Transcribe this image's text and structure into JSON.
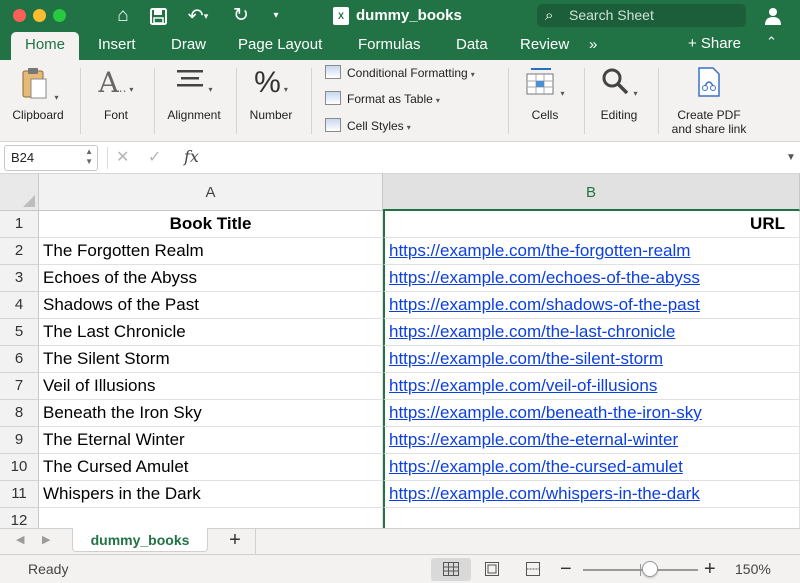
{
  "window": {
    "title": "dummy_books",
    "file_badge": "X",
    "search_placeholder": "Search Sheet",
    "accent_color": "#217346"
  },
  "quick_access": {
    "icons": [
      "home-icon",
      "save-icon",
      "undo-icon",
      "redo-icon"
    ]
  },
  "tabs": [
    {
      "label": "Home",
      "active": true
    },
    {
      "label": "Insert"
    },
    {
      "label": "Draw"
    },
    {
      "label": "Page Layout"
    },
    {
      "label": "Formulas"
    },
    {
      "label": "Data"
    },
    {
      "label": "Review"
    },
    {
      "label": "»"
    }
  ],
  "share": {
    "label": "+ Share",
    "collapse": "⌃"
  },
  "ribbon": {
    "clipboard": "Clipboard",
    "font": "Font",
    "alignment": "Alignment",
    "number": "Number",
    "conditional_formatting": "Conditional Formatting",
    "format_as_table": "Format as Table",
    "cell_styles": "Cell Styles",
    "cells": "Cells",
    "editing": "Editing",
    "create_pdf_line1": "Create PDF",
    "create_pdf_line2": "and share link"
  },
  "formula_bar": {
    "name_box": "B24",
    "cancel": "✕",
    "enter": "✓",
    "fx": "fx",
    "content": ""
  },
  "columns": [
    {
      "label": "A",
      "selected": false
    },
    {
      "label": "B",
      "selected": true
    }
  ],
  "rows": [
    {
      "num": "1",
      "a": "Book Title",
      "b": "URL"
    },
    {
      "num": "2",
      "a": "The Forgotten Realm",
      "b": "https://example.com/the-forgotten-realm"
    },
    {
      "num": "3",
      "a": "Echoes of the Abyss",
      "b": "https://example.com/echoes-of-the-abyss"
    },
    {
      "num": "4",
      "a": "Shadows of the Past",
      "b": "https://example.com/shadows-of-the-past"
    },
    {
      "num": "5",
      "a": "The Last Chronicle",
      "b": "https://example.com/the-last-chronicle"
    },
    {
      "num": "6",
      "a": "The Silent Storm",
      "b": "https://example.com/the-silent-storm"
    },
    {
      "num": "7",
      "a": "Veil of Illusions",
      "b": "https://example.com/veil-of-illusions"
    },
    {
      "num": "8",
      "a": "Beneath the Iron Sky",
      "b": "https://example.com/beneath-the-iron-sky"
    },
    {
      "num": "9",
      "a": "The Eternal Winter",
      "b": "https://example.com/the-eternal-winter"
    },
    {
      "num": "10",
      "a": "The Cursed Amulet",
      "b": "https://example.com/the-cursed-amulet"
    },
    {
      "num": "11",
      "a": "Whispers in the Dark",
      "b": "https://example.com/whispers-in-the-dark"
    },
    {
      "num": "12",
      "a": "",
      "b": ""
    }
  ],
  "sheets": {
    "active": "dummy_books",
    "add": "+"
  },
  "status": {
    "ready": "Ready",
    "zoom": "150%",
    "zoom_level_percent": 150
  }
}
